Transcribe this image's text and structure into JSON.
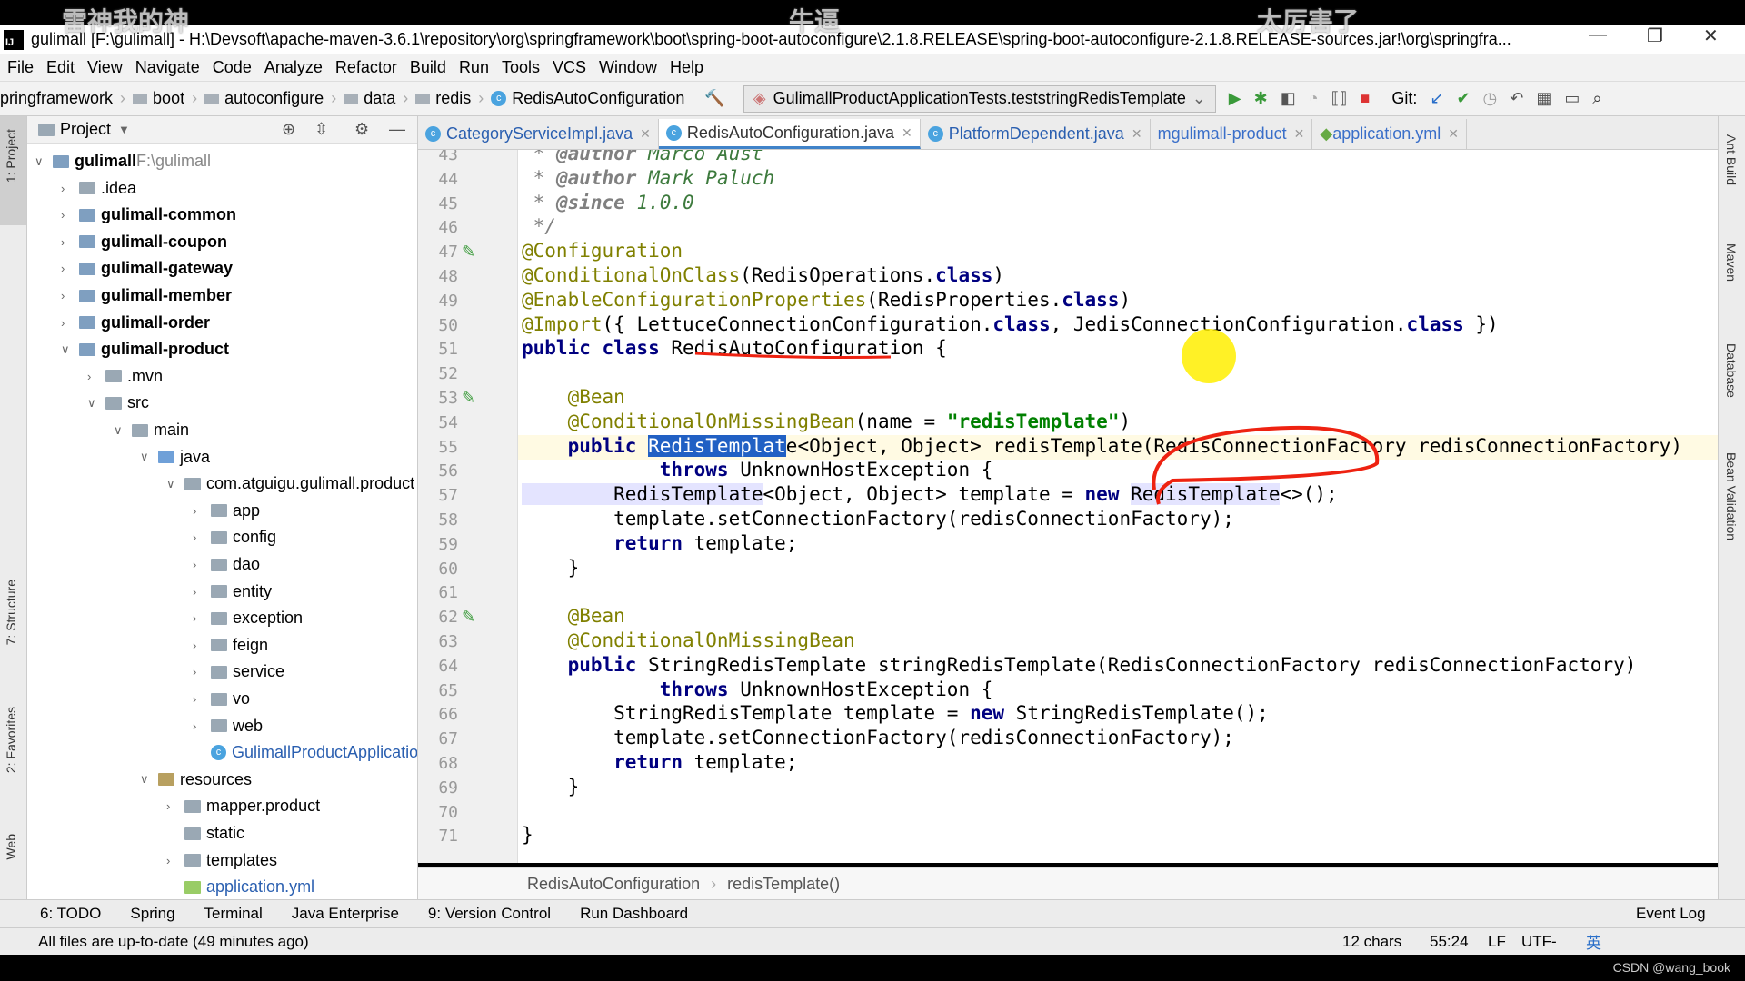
{
  "subtitles": [
    "雷神我的神",
    "牛逼",
    "太厉害了"
  ],
  "title": "gulimall [F:\\gulimall] - H:\\Devsoft\\apache-maven-3.6.1\\repository\\org\\springframework\\boot\\spring-boot-autoconfigure\\2.1.8.RELEASE\\spring-boot-autoconfigure-2.1.8.RELEASE-sources.jar!\\org\\springfra...",
  "menu": [
    "File",
    "Edit",
    "View",
    "Navigate",
    "Code",
    "Analyze",
    "Refactor",
    "Build",
    "Run",
    "Tools",
    "VCS",
    "Window",
    "Help"
  ],
  "breadcrumb": [
    "pringframework",
    "boot",
    "autoconfigure",
    "data",
    "redis",
    "RedisAutoConfiguration"
  ],
  "run_config": "GulimallProductApplicationTests.teststringRedisTemplate",
  "git_label": "Git:",
  "project": {
    "header": "Project",
    "root_path": "F:\\gulimall",
    "tree": [
      {
        "label": "gulimall",
        "depth": 0,
        "open": true,
        "bold": true,
        "icon": "module",
        "path": "F:\\gulimall"
      },
      {
        "label": ".idea",
        "depth": 1,
        "open": false,
        "icon": "folder"
      },
      {
        "label": "gulimall-common",
        "depth": 1,
        "open": false,
        "bold": true,
        "icon": "module"
      },
      {
        "label": "gulimall-coupon",
        "depth": 1,
        "open": false,
        "bold": true,
        "icon": "module"
      },
      {
        "label": "gulimall-gateway",
        "depth": 1,
        "open": false,
        "bold": true,
        "icon": "module"
      },
      {
        "label": "gulimall-member",
        "depth": 1,
        "open": false,
        "bold": true,
        "icon": "module"
      },
      {
        "label": "gulimall-order",
        "depth": 1,
        "open": false,
        "bold": true,
        "icon": "module"
      },
      {
        "label": "gulimall-product",
        "depth": 1,
        "open": true,
        "bold": true,
        "icon": "module"
      },
      {
        "label": ".mvn",
        "depth": 2,
        "open": false,
        "icon": "folder"
      },
      {
        "label": "src",
        "depth": 2,
        "open": true,
        "icon": "folder"
      },
      {
        "label": "main",
        "depth": 3,
        "open": true,
        "icon": "folder"
      },
      {
        "label": "java",
        "depth": 4,
        "open": true,
        "icon": "source-folder"
      },
      {
        "label": "com.atguigu.gulimall.product",
        "depth": 5,
        "open": true,
        "icon": "package"
      },
      {
        "label": "app",
        "depth": 6,
        "open": false,
        "icon": "package"
      },
      {
        "label": "config",
        "depth": 6,
        "open": false,
        "icon": "package"
      },
      {
        "label": "dao",
        "depth": 6,
        "open": false,
        "icon": "package"
      },
      {
        "label": "entity",
        "depth": 6,
        "open": false,
        "icon": "package"
      },
      {
        "label": "exception",
        "depth": 6,
        "open": false,
        "icon": "package"
      },
      {
        "label": "feign",
        "depth": 6,
        "open": false,
        "icon": "package"
      },
      {
        "label": "service",
        "depth": 6,
        "open": false,
        "icon": "package"
      },
      {
        "label": "vo",
        "depth": 6,
        "open": false,
        "icon": "package"
      },
      {
        "label": "web",
        "depth": 6,
        "open": false,
        "icon": "package"
      },
      {
        "label": "GulimallProductApplication",
        "depth": 6,
        "icon": "spring-class",
        "link": true
      },
      {
        "label": "resources",
        "depth": 4,
        "open": true,
        "icon": "resources-folder"
      },
      {
        "label": "mapper.product",
        "depth": 5,
        "open": false,
        "icon": "folder"
      },
      {
        "label": "static",
        "depth": 5,
        "icon": "folder"
      },
      {
        "label": "templates",
        "depth": 5,
        "open": false,
        "icon": "folder"
      },
      {
        "label": "application.yml",
        "depth": 5,
        "icon": "yaml-file",
        "link": true
      }
    ]
  },
  "left_strip": [
    "1: Project",
    "7: Structure",
    "2: Favorites",
    "Web"
  ],
  "right_strip": [
    "Ant Build",
    "Maven",
    "Database",
    "Bean Validation"
  ],
  "tabs": [
    {
      "label": "CategoryServiceImpl.java",
      "icon": "class",
      "active": false
    },
    {
      "label": "RedisAutoConfiguration.java",
      "icon": "class",
      "active": true
    },
    {
      "label": "PlatformDependent.java",
      "icon": "class",
      "active": false
    },
    {
      "label": "gulimall-product",
      "icon": "maven",
      "active": false
    },
    {
      "label": "application.yml",
      "icon": "yaml",
      "active": false
    }
  ],
  "code": {
    "first_line": 43,
    "current_line": 55,
    "lines": [
      [
        [
          "cm",
          " * "
        ],
        [
          "ct",
          "@author"
        ],
        [
          "cv",
          " Marco Aust"
        ]
      ],
      [
        [
          "cm",
          " * "
        ],
        [
          "ct",
          "@author"
        ],
        [
          "cv",
          " Mark Paluch"
        ]
      ],
      [
        [
          "cm",
          " * "
        ],
        [
          "ct",
          "@since"
        ],
        [
          "cv",
          " 1.0.0"
        ]
      ],
      [
        [
          "cm",
          " */"
        ]
      ],
      [
        [
          "an",
          "@Configuration"
        ]
      ],
      [
        [
          "an",
          "@ConditionalOnClass"
        ],
        [
          "",
          "(RedisOperations."
        ],
        [
          "kw",
          "class"
        ],
        [
          "",
          ")"
        ]
      ],
      [
        [
          "an",
          "@EnableConfigurationProperties"
        ],
        [
          "",
          "(RedisProperties."
        ],
        [
          "kw",
          "class"
        ],
        [
          "",
          ")"
        ]
      ],
      [
        [
          "an",
          "@Import"
        ],
        [
          "",
          "({ LettuceConnectionConfiguration."
        ],
        [
          "kw",
          "class"
        ],
        [
          "",
          ", JedisConnectionConfiguration."
        ],
        [
          "kw",
          "class"
        ],
        [
          "",
          " })"
        ]
      ],
      [
        [
          "kw",
          "public class"
        ],
        [
          "",
          " RedisAutoConfiguration {"
        ]
      ],
      [],
      [
        [
          "an",
          "    @Bean"
        ]
      ],
      [
        [
          "an",
          "    @ConditionalOnMissingBean"
        ],
        [
          "",
          "(name = "
        ],
        [
          "st",
          "\"redisTemplate\""
        ],
        [
          "",
          ")"
        ]
      ],
      [
        [
          "kw",
          "    public "
        ],
        [
          "sel",
          "RedisTemplat"
        ],
        [
          "",
          "e<Object, Object> redisTemplate(RedisConnectionFactory redisConnectionFactory)"
        ]
      ],
      [
        [
          "kw",
          "            throws"
        ],
        [
          "",
          " UnknownHostException {"
        ]
      ],
      [
        [
          "hl",
          "        RedisTemplate"
        ],
        [
          "",
          "<Object, Object> template = "
        ],
        [
          "kw",
          "new "
        ],
        [
          "hl",
          "RedisTemplate"
        ],
        [
          "",
          "<>();"
        ]
      ],
      [
        [
          "",
          "        template.setConnectionFactory(redisConnectionFactory);"
        ]
      ],
      [
        [
          "kw",
          "        return"
        ],
        [
          "",
          " template;"
        ]
      ],
      [
        [
          "",
          "    }"
        ]
      ],
      [],
      [
        [
          "an",
          "    @Bean"
        ]
      ],
      [
        [
          "an",
          "    @ConditionalOnMissingBean"
        ]
      ],
      [
        [
          "kw",
          "    public"
        ],
        [
          "",
          " StringRedisTemplate stringRedisTemplate(RedisConnectionFactory redisConnectionFactory)"
        ]
      ],
      [
        [
          "kw",
          "            throws"
        ],
        [
          "",
          " UnknownHostException {"
        ]
      ],
      [
        [
          "",
          "        StringRedisTemplate template = "
        ],
        [
          "kw",
          "new"
        ],
        [
          "",
          " StringRedisTemplate();"
        ]
      ],
      [
        [
          "",
          "        template.setConnectionFactory(redisConnectionFactory);"
        ]
      ],
      [
        [
          "kw",
          "        return"
        ],
        [
          "",
          " template;"
        ]
      ],
      [
        [
          "",
          "    }"
        ]
      ],
      [],
      [
        [
          "",
          "}"
        ]
      ]
    ]
  },
  "editor_breadcrumb": [
    "RedisAutoConfiguration",
    "redisTemplate()"
  ],
  "bottom_tools": [
    "6: TODO",
    "Spring",
    "Terminal",
    "Java Enterprise",
    "9: Version Control",
    "Run Dashboard"
  ],
  "event_log": "Event Log",
  "status": {
    "message": "All files are up-to-date (49 minutes ago)",
    "selection": "12 chars",
    "position": "55:24",
    "line_sep": "LF",
    "encoding": "UTF-",
    "ime": "英"
  },
  "watermark": "CSDN @wang_book",
  "colors": {
    "keyword": "#000080",
    "annotation": "#808000",
    "string": "#008000",
    "selection": "#2160c4",
    "accent": "#4083c9"
  }
}
